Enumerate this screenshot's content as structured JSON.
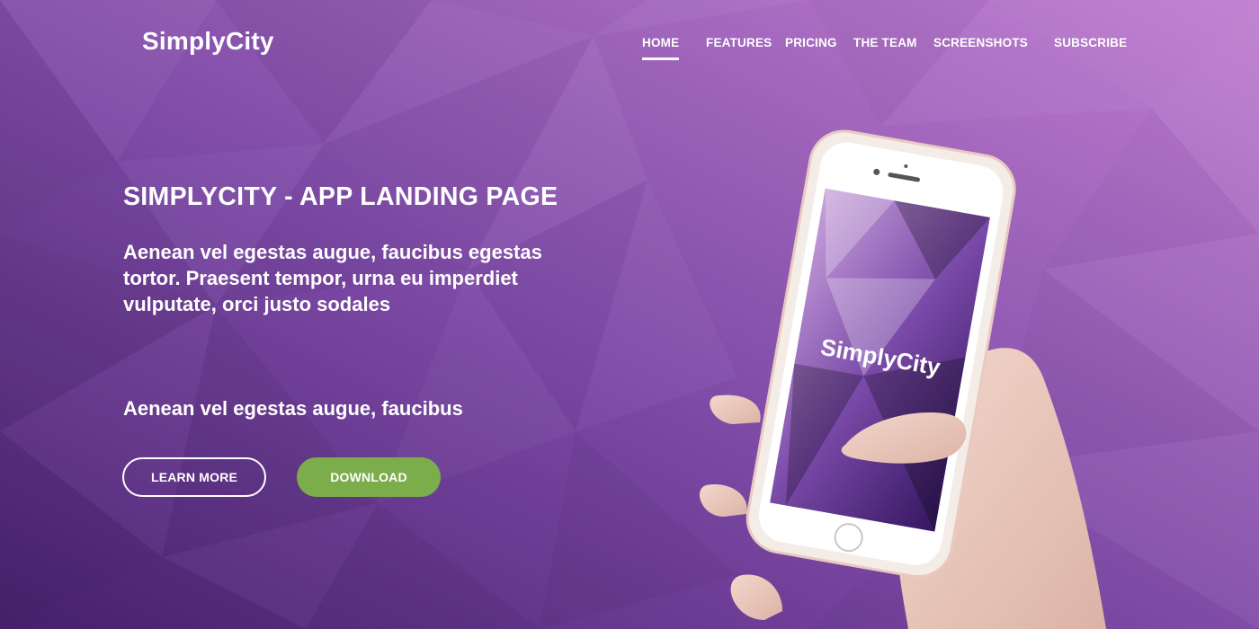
{
  "brand": {
    "name": "SimplyCity"
  },
  "nav": {
    "items": [
      {
        "label": "HOME",
        "active": true
      },
      {
        "label": "FEATURES",
        "active": false
      },
      {
        "label": "PRICING",
        "active": false
      },
      {
        "label": "THE TEAM",
        "active": false
      },
      {
        "label": "SCREENSHOTS",
        "active": false
      },
      {
        "label": "SUBSCRIBE",
        "active": false
      }
    ]
  },
  "hero": {
    "title": "SIMPLYCITY - APP LANDING PAGE",
    "description": "Aenean vel egestas augue, faucibus egestas tortor. Praesent tempor, urna eu imperdiet vulputate, orci justo sodales",
    "subtitle": "Aenean vel egestas augue, faucibus",
    "learn_more_label": "LEARN MORE",
    "download_label": "DOWNLOAD"
  },
  "phone": {
    "screen_logo": "SimplyCity"
  },
  "colors": {
    "background_dark": "#4e2576",
    "background_light": "#b778c8",
    "download_button": "#7cad4b",
    "text": "#ffffff"
  }
}
